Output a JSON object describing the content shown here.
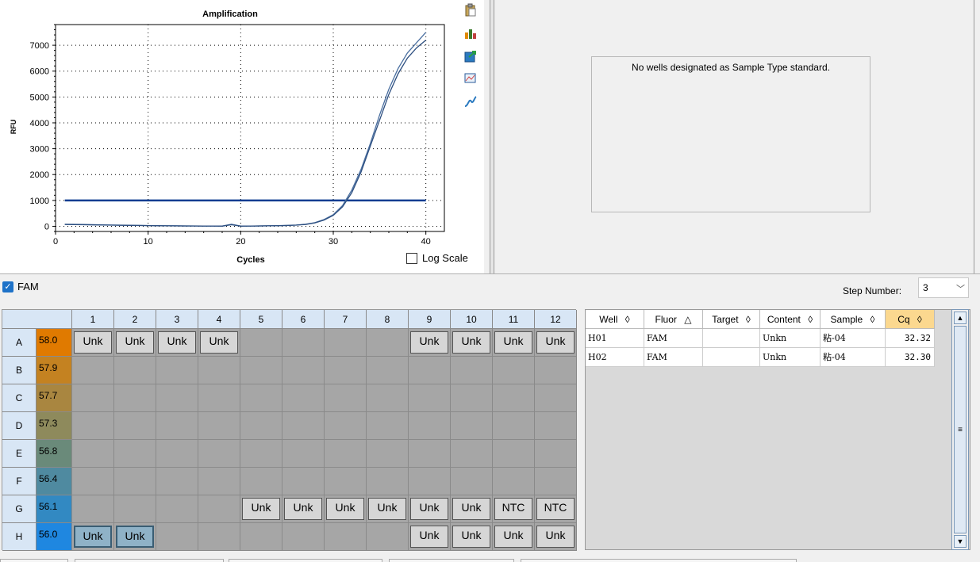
{
  "chart": {
    "title": "Amplification",
    "xlabel": "Cycles",
    "ylabel": "RFU",
    "log_scale_label": "Log Scale"
  },
  "chart_data": {
    "type": "line",
    "title": "Amplification",
    "xlabel": "Cycles",
    "ylabel": "RFU",
    "xlim": [
      0,
      42
    ],
    "ylim": [
      -200,
      7800
    ],
    "x_ticks": [
      0,
      10,
      20,
      30,
      40
    ],
    "y_ticks": [
      0,
      1000,
      2000,
      3000,
      4000,
      5000,
      6000,
      7000
    ],
    "grid": true,
    "threshold": 1000,
    "series": [
      {
        "x": [
          1,
          2,
          3,
          4,
          5,
          6,
          7,
          8,
          9,
          10,
          11,
          12,
          13,
          14,
          15,
          16,
          17,
          18,
          19,
          20,
          21,
          22,
          23,
          24,
          25,
          26,
          27,
          28,
          29,
          30,
          31,
          32,
          33,
          34,
          35,
          36,
          37,
          38,
          39,
          40
        ],
        "values": [
          80,
          75,
          70,
          65,
          55,
          50,
          45,
          40,
          35,
          30,
          25,
          20,
          20,
          15,
          15,
          10,
          10,
          10,
          80,
          10,
          10,
          15,
          20,
          25,
          35,
          50,
          80,
          140,
          260,
          450,
          800,
          1400,
          2200,
          3200,
          4300,
          5300,
          6100,
          6700,
          7100,
          7500
        ]
      },
      {
        "x": [
          1,
          2,
          3,
          4,
          5,
          6,
          7,
          8,
          9,
          10,
          11,
          12,
          13,
          14,
          15,
          16,
          17,
          18,
          19,
          20,
          21,
          22,
          23,
          24,
          25,
          26,
          27,
          28,
          29,
          30,
          31,
          32,
          33,
          34,
          35,
          36,
          37,
          38,
          39,
          40
        ],
        "values": [
          70,
          65,
          60,
          55,
          50,
          45,
          40,
          35,
          30,
          25,
          20,
          18,
          15,
          12,
          10,
          8,
          6,
          5,
          60,
          5,
          8,
          12,
          18,
          22,
          30,
          45,
          70,
          130,
          240,
          420,
          750,
          1300,
          2100,
          3100,
          4100,
          5100,
          5900,
          6500,
          6900,
          7200
        ]
      }
    ]
  },
  "standard_message": "No wells designated as Sample Type standard.",
  "fluor_filter": {
    "label": "FAM",
    "checked": true
  },
  "step": {
    "label": "Step Number:",
    "value": "3"
  },
  "plate": {
    "columns": [
      "1",
      "2",
      "3",
      "4",
      "5",
      "6",
      "7",
      "8",
      "9",
      "10",
      "11",
      "12"
    ],
    "rows": [
      {
        "label": "A",
        "temp": "58.0",
        "color": "#e07a00",
        "wells": [
          "Unk",
          "Unk",
          "Unk",
          "Unk",
          "",
          "",
          "",
          "",
          "Unk",
          "Unk",
          "Unk",
          "Unk"
        ]
      },
      {
        "label": "B",
        "temp": "57.9",
        "color": "#c48221",
        "wells": [
          "",
          "",
          "",
          "",
          "",
          "",
          "",
          "",
          "",
          "",
          "",
          ""
        ]
      },
      {
        "label": "C",
        "temp": "57.7",
        "color": "#a98640",
        "wells": [
          "",
          "",
          "",
          "",
          "",
          "",
          "",
          "",
          "",
          "",
          "",
          ""
        ]
      },
      {
        "label": "D",
        "temp": "57.3",
        "color": "#8e8a5c",
        "wells": [
          "",
          "",
          "",
          "",
          "",
          "",
          "",
          "",
          "",
          "",
          "",
          ""
        ]
      },
      {
        "label": "E",
        "temp": "56.8",
        "color": "#6a8a7a",
        "wells": [
          "",
          "",
          "",
          "",
          "",
          "",
          "",
          "",
          "",
          "",
          "",
          ""
        ]
      },
      {
        "label": "F",
        "temp": "56.4",
        "color": "#4f8aa0",
        "wells": [
          "",
          "",
          "",
          "",
          "",
          "",
          "",
          "",
          "",
          "",
          "",
          ""
        ]
      },
      {
        "label": "G",
        "temp": "56.1",
        "color": "#3289c2",
        "wells": [
          "",
          "",
          "",
          "",
          "Unk",
          "Unk",
          "Unk",
          "Unk",
          "Unk",
          "Unk",
          "NTC",
          "NTC"
        ]
      },
      {
        "label": "H",
        "temp": "56.0",
        "color": "#1f87e0",
        "wells": [
          "Unk",
          "Unk",
          "",
          "",
          "",
          "",
          "",
          "",
          "Unk",
          "Unk",
          "Unk",
          "Unk"
        ]
      }
    ],
    "selected": [
      "H1",
      "H2"
    ]
  },
  "results": {
    "headers": [
      "Well",
      "Fluor",
      "Target",
      "Content",
      "Sample",
      "Cq"
    ],
    "sort_glyphs": [
      "◊",
      "△",
      "◊",
      "◊",
      "◊",
      "◊"
    ],
    "rows": [
      [
        "H01",
        "FAM",
        "",
        "Unkn",
        "粘-04",
        "32.32"
      ],
      [
        "H02",
        "FAM",
        "",
        "Unkn",
        "粘-04",
        "32.30"
      ]
    ]
  },
  "icons": [
    "clipboard-icon",
    "chart-settings-icon",
    "export-icon",
    "zoom-chart-icon",
    "curve-icon"
  ]
}
